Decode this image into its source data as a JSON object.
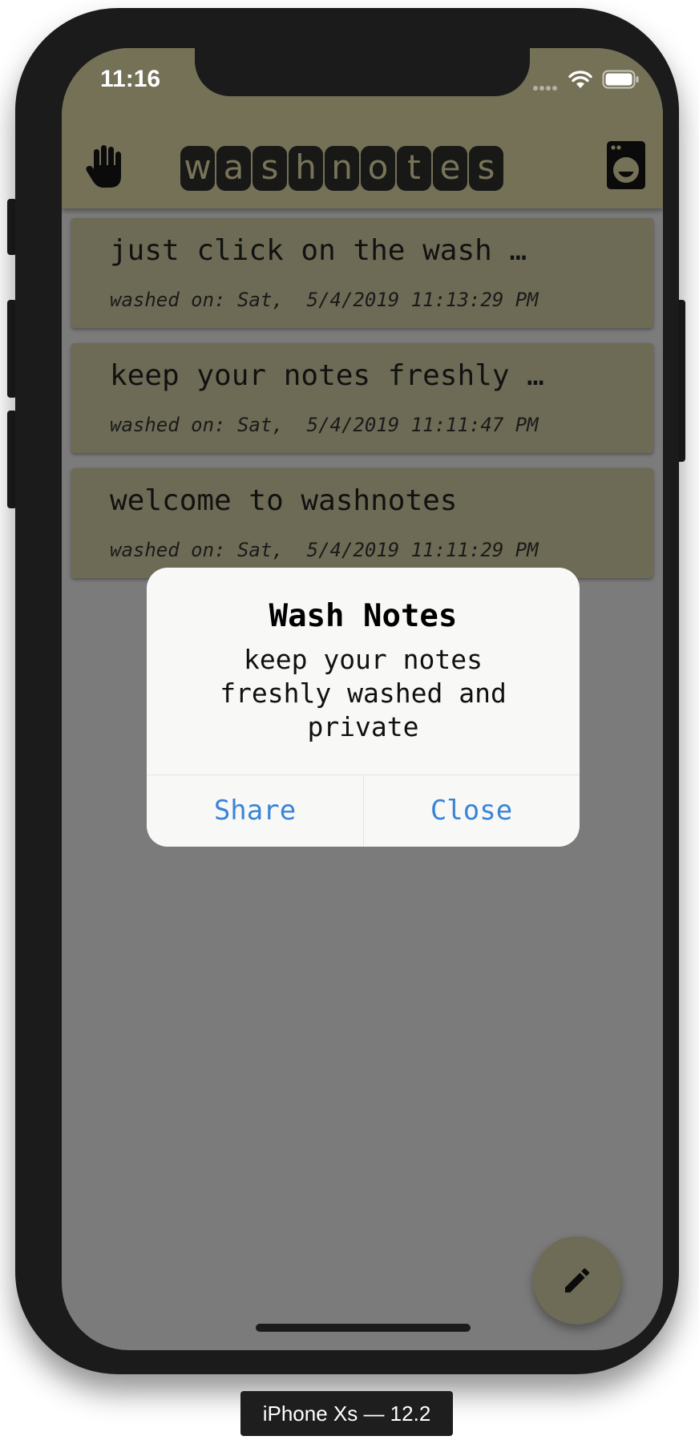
{
  "status_bar": {
    "time": "11:16",
    "icons": [
      "signal-dots-icon",
      "wifi-icon",
      "battery-icon"
    ]
  },
  "header": {
    "left_icon": "hand-icon",
    "logo_letters": [
      "w",
      "a",
      "s",
      "h",
      "n",
      "o",
      "t",
      "e",
      "s"
    ],
    "right_icon": "washing-machine-icon"
  },
  "notes": [
    {
      "title": "just click on the wash …",
      "date": "washed on: Sat,  5/4/2019 11:13:29 PM"
    },
    {
      "title": "keep your notes freshly …",
      "date": "washed on: Sat,  5/4/2019 11:11:47 PM"
    },
    {
      "title": "welcome to washnotes",
      "date": "washed on: Sat,  5/4/2019 11:11:29 PM"
    }
  ],
  "alert": {
    "title": "Wash Notes",
    "message": "keep your notes freshly washed and private",
    "buttons": {
      "share": "Share",
      "close": "Close"
    }
  },
  "fab": {
    "icon": "pencil-icon"
  },
  "device_label": "iPhone Xs — 12.2",
  "colors": {
    "header_bg": "#747157",
    "card_bg": "#6d6b55",
    "overlay_bg": "#7b7b7b",
    "alert_button": "#3a84d8"
  }
}
